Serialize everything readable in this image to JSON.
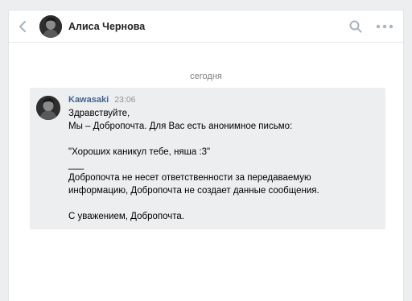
{
  "header": {
    "title": "Алиса Чернова",
    "back_icon": "chevron-left-icon",
    "search_icon": "search-icon",
    "more_icon": "more-horizontal-icon"
  },
  "date_separator": "сегодня",
  "message": {
    "sender": "Kawasaki",
    "time": "23:06",
    "lines": [
      "Здравствуйте,",
      "Мы – Добропочта. Для Вас есть анонимное письмо:",
      "",
      "\"Хороших каникул тебе, няша :3\"",
      "___",
      "Добропочта не несет ответственности за передаваемую",
      "информацию, Добропочта не создает данные сообщения.",
      "",
      "С уважением, Добропочта."
    ]
  },
  "colors": {
    "sender_link": "#42648b",
    "timestamp": "#939393",
    "message_background": "#edeef0",
    "icon_gray": "#a8b3c1"
  }
}
